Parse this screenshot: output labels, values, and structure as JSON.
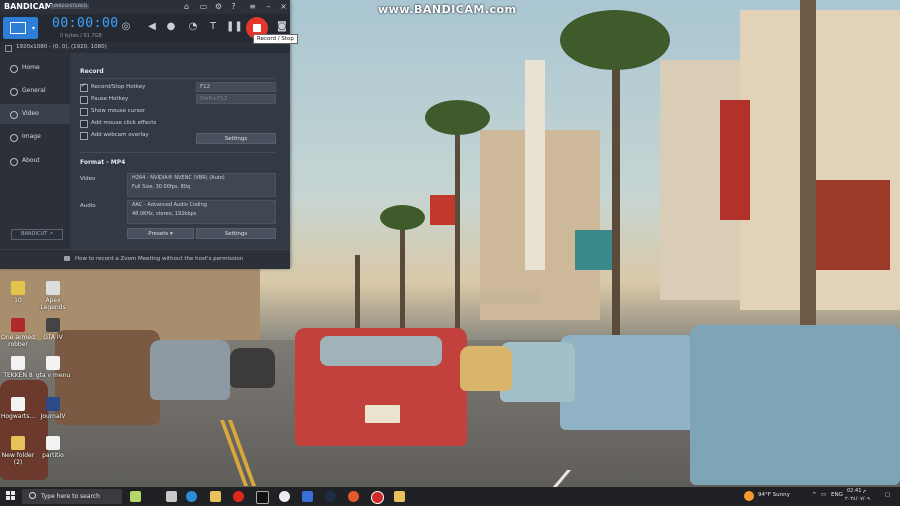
{
  "watermark": "www.BANDICAM.com",
  "app": {
    "brand": "BANDICAM",
    "unregistered": "UNREGISTERED",
    "timer": "00:00:00",
    "bytes": "0 bytes / 91.7GB",
    "tooltip": "Record / Stop",
    "coords": "1920x1080 - (0, 0), (1920, 1080)"
  },
  "sidebar": {
    "items": [
      {
        "label": "Home"
      },
      {
        "label": "General"
      },
      {
        "label": "Video"
      },
      {
        "label": "Image"
      },
      {
        "label": "About"
      }
    ],
    "bandicut": "BANDICUT ↗"
  },
  "record": {
    "title": "Record",
    "hotkey_label": "Record/Stop Hotkey",
    "hotkey_value": "F12",
    "pause_label": "Pause Hotkey",
    "pause_value": "Shift+F12",
    "show_cursor": "Show mouse cursor",
    "click_effects": "Add mouse click effects",
    "webcam": "Add webcam overlay",
    "settings": "Settings"
  },
  "format": {
    "title": "Format - MP4",
    "video_label": "Video",
    "video_line1": "H264 - NVIDIA® NVENC (VBR) (Auto)",
    "video_line2": "Full Size, 30.00fps, 80q",
    "audio_label": "Audio",
    "audio_line1": "AAC - Advanced Audio Coding",
    "audio_line2": "48.0KHz, stereo, 192kbps",
    "presets": "Presets",
    "settings": "Settings"
  },
  "footer": "How to record a Zoom Meeting without the host's permission",
  "desktop_icons": [
    {
      "label": "10"
    },
    {
      "label": "Apex Legends"
    },
    {
      "label": "One-armed robber"
    },
    {
      "label": "GTA IV"
    },
    {
      "label": "TEKKEN 8"
    },
    {
      "label": "gta v menu"
    },
    {
      "label": "Hogwarts..."
    },
    {
      "label": "JournalV"
    },
    {
      "label": "New folder (2)"
    },
    {
      "label": "partitio"
    }
  ],
  "taskbar": {
    "search_placeholder": "Type here to search",
    "weather": "94°F Sunny",
    "lang": "ENG",
    "time": "02:41 م",
    "date": "٢٠٢٤/٠٧/٠٩"
  },
  "colors": {
    "accent": "#2e7dd6",
    "timer": "#3da3ff",
    "record": "#e5352d",
    "panel": "#303641"
  }
}
